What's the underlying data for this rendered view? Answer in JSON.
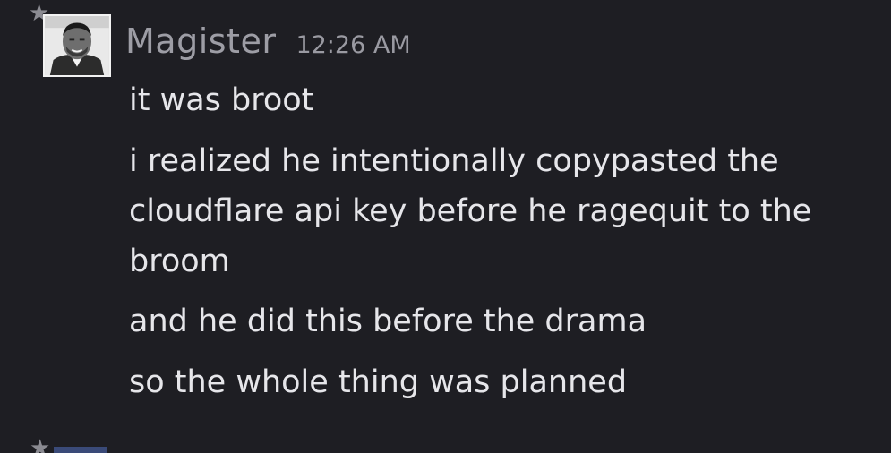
{
  "message": {
    "username": "Magister",
    "timestamp": "12:26 AM",
    "avatar_icon": "man-portrait-avatar",
    "lines": [
      "it was broot",
      "i realized he intentionally copypasted the cloudflare api key before he ragequit to the broom",
      "and he did this before the drama",
      "so the whole thing was planned"
    ]
  },
  "colors": {
    "background": "#1e1e23",
    "username": "#9d9da5",
    "timestamp": "#9a9aa2",
    "message_text": "#e6e6ea",
    "star": "#8b8b92"
  }
}
